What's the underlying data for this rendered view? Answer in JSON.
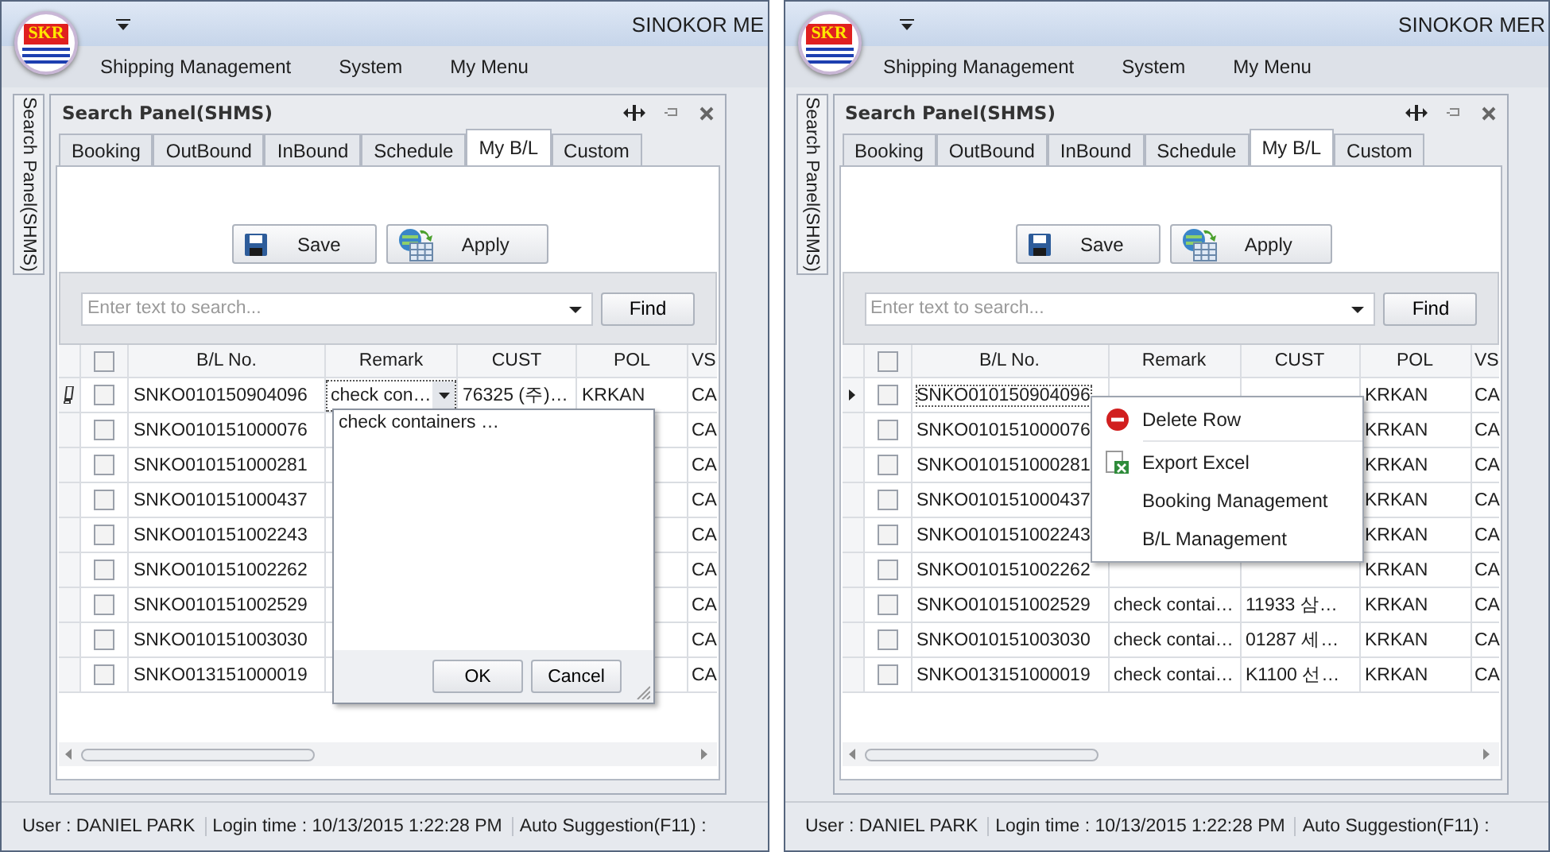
{
  "windows": [
    {
      "title": "SINOKOR ME",
      "logo": "SKR",
      "menu": [
        "Shipping Management",
        "System",
        "My Menu"
      ],
      "side_tab": "Search Panel(SHMS)",
      "panel_title": "Search Panel(SHMS)",
      "tabs": [
        {
          "label": "Booking",
          "selected": false
        },
        {
          "label": "OutBound",
          "selected": false
        },
        {
          "label": "InBound",
          "selected": false
        },
        {
          "label": "Schedule",
          "selected": false
        },
        {
          "label": "My B/L",
          "selected": true
        },
        {
          "label": "Custom",
          "selected": false
        }
      ],
      "buttons": [
        {
          "label": "Save",
          "kind": "save"
        },
        {
          "label": "Apply",
          "kind": "apply"
        }
      ],
      "search": {
        "placeholder": "Enter text to search..."
      },
      "find_button": "Find",
      "columns": [
        "B/L No.",
        "Remark",
        "CUST",
        "POL",
        "VS"
      ],
      "header_checked": false,
      "rows": [
        {
          "editing": true,
          "current": false,
          "checked": false,
          "bl": "SNKO010150904096",
          "remark": "check con…",
          "cust": "76325 (주)…",
          "pol": "KRKAN",
          "vsl": "CA"
        },
        {
          "editing": false,
          "current": false,
          "checked": false,
          "bl": "SNKO010151000076",
          "vsl": "CA"
        },
        {
          "editing": false,
          "current": false,
          "checked": false,
          "bl": "SNKO010151000281",
          "vsl": "CA"
        },
        {
          "editing": false,
          "current": false,
          "checked": false,
          "bl": "SNKO010151000437",
          "vsl": "CA"
        },
        {
          "editing": false,
          "current": false,
          "checked": false,
          "bl": "SNKO010151002243",
          "vsl": "CA"
        },
        {
          "editing": false,
          "current": false,
          "checked": false,
          "bl": "SNKO010151002262",
          "vsl": "CA"
        },
        {
          "editing": false,
          "current": false,
          "checked": false,
          "bl": "SNKO010151002529",
          "vsl": "CA"
        },
        {
          "editing": false,
          "current": false,
          "checked": false,
          "bl": "SNKO010151003030",
          "vsl": "CA"
        },
        {
          "editing": false,
          "current": false,
          "checked": false,
          "bl": "SNKO013151000019",
          "vsl": "CA"
        }
      ],
      "overlay": {
        "kind": "text_editor",
        "text": "check containers …",
        "ok": "OK",
        "cancel": "Cancel"
      },
      "status": [
        "User : DANIEL PARK",
        "Login time : 10/13/2015 1:22:28 PM",
        "Auto Suggestion(F11) :"
      ]
    },
    {
      "title": "SINOKOR MER",
      "logo": "SKR",
      "menu": [
        "Shipping Management",
        "System",
        "My Menu"
      ],
      "side_tab": "Search Panel(SHMS)",
      "panel_title": "Search Panel(SHMS)",
      "tabs": [
        {
          "label": "Booking",
          "selected": false
        },
        {
          "label": "OutBound",
          "selected": false
        },
        {
          "label": "InBound",
          "selected": false
        },
        {
          "label": "Schedule",
          "selected": false
        },
        {
          "label": "My B/L",
          "selected": true
        },
        {
          "label": "Custom",
          "selected": false
        }
      ],
      "buttons": [
        {
          "label": "Save",
          "kind": "save"
        },
        {
          "label": "Apply",
          "kind": "apply"
        }
      ],
      "search": {
        "placeholder": "Enter text to search..."
      },
      "find_button": "Find",
      "columns": [
        "B/L No.",
        "Remark",
        "CUST",
        "POL",
        "VS"
      ],
      "header_checked": false,
      "rows": [
        {
          "editing": false,
          "current": true,
          "checked": false,
          "bl": "SNKO010150904096",
          "pol": "KRKAN",
          "vsl": "CA"
        },
        {
          "editing": false,
          "current": false,
          "checked": false,
          "bl": "SNKO010151000076",
          "pol": "KRKAN",
          "vsl": "CA"
        },
        {
          "editing": false,
          "current": false,
          "checked": false,
          "bl": "SNKO010151000281",
          "pol": "KRKAN",
          "vsl": "CA"
        },
        {
          "editing": false,
          "current": false,
          "checked": false,
          "bl": "SNKO010151000437",
          "pol": "KRKAN",
          "vsl": "CA"
        },
        {
          "editing": false,
          "current": false,
          "checked": false,
          "bl": "SNKO010151002243",
          "pol": "KRKAN",
          "vsl": "CA"
        },
        {
          "editing": false,
          "current": false,
          "checked": false,
          "bl": "SNKO010151002262",
          "pol": "KRKAN",
          "vsl": "CA"
        },
        {
          "editing": false,
          "current": false,
          "checked": false,
          "bl": "SNKO010151002529",
          "remark": "check contai…",
          "cust": "11933 삼…",
          "pol": "KRKAN",
          "vsl": "CA"
        },
        {
          "editing": false,
          "current": false,
          "checked": false,
          "bl": "SNKO010151003030",
          "remark": "check contai…",
          "cust": "01287 세…",
          "pol": "KRKAN",
          "vsl": "CA"
        },
        {
          "editing": false,
          "current": false,
          "checked": false,
          "bl": "SNKO013151000019",
          "remark": "check contai…",
          "cust": "K1100 선…",
          "pol": "KRKAN",
          "vsl": "CA"
        }
      ],
      "overlay": {
        "kind": "context_menu",
        "items": [
          {
            "label": "Delete Row",
            "kind": "delete"
          },
          {
            "label": "Export Excel",
            "kind": "export"
          },
          {
            "label": "Booking Management",
            "kind": "plain"
          },
          {
            "label": "B/L Management",
            "kind": "plain"
          }
        ]
      },
      "status": [
        "User : DANIEL PARK",
        "Login time : 10/13/2015 1:22:28 PM",
        "Auto Suggestion(F11) :"
      ]
    }
  ]
}
